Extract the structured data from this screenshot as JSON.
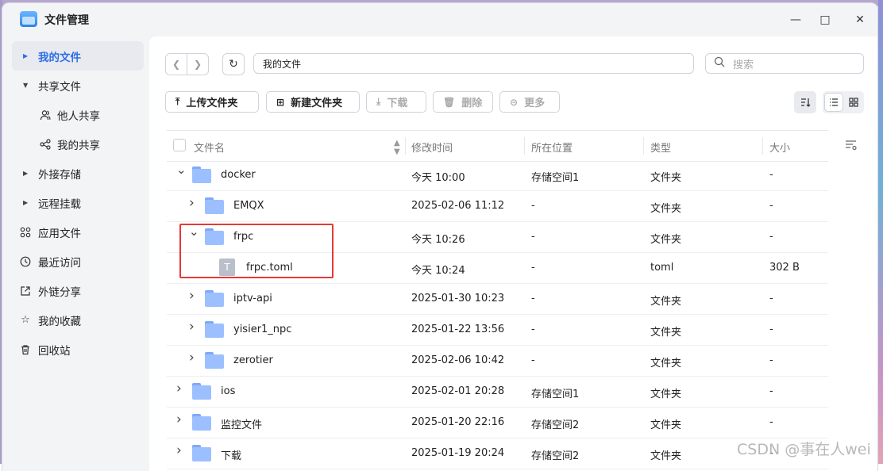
{
  "window": {
    "title": "文件管理",
    "minimize_icon": "minimize-icon",
    "maximize_icon": "maximize-icon",
    "close_icon": "close-icon"
  },
  "sidebar": {
    "items": [
      {
        "label": "我的文件",
        "icon": "caret-right-icon",
        "active": true
      },
      {
        "label": "共享文件",
        "icon": "caret-down-icon"
      },
      {
        "label": "他人共享",
        "icon": "users-icon",
        "sub": true
      },
      {
        "label": "我的共享",
        "icon": "share-icon",
        "sub": true
      },
      {
        "label": "外接存储",
        "icon": "caret-right-icon"
      },
      {
        "label": "远程挂载",
        "icon": "caret-right-icon"
      },
      {
        "label": "应用文件",
        "icon": "apps-icon"
      },
      {
        "label": "最近访问",
        "icon": "clock-icon"
      },
      {
        "label": "外链分享",
        "icon": "external-link-icon"
      },
      {
        "label": "我的收藏",
        "icon": "star-icon"
      },
      {
        "label": "回收站",
        "icon": "trash-icon"
      }
    ]
  },
  "toolbar": {
    "path": "我的文件",
    "search_placeholder": "搜索",
    "upload_label": "上传文件夹",
    "new_folder_label": "新建文件夹",
    "download_label": "下载",
    "delete_label": "删除",
    "more_label": "更多"
  },
  "table": {
    "headers": {
      "name": "文件名",
      "modified": "修改时间",
      "location": "所在位置",
      "type": "类型",
      "size": "大小"
    },
    "rows": [
      {
        "name": "docker",
        "modified": "今天 10:00",
        "location": "存储空间1",
        "type": "文件夹",
        "size": "-",
        "level": 0,
        "kind": "folder",
        "expand": "down"
      },
      {
        "name": "EMQX",
        "modified": "2025-02-06 11:12",
        "location": "-",
        "type": "文件夹",
        "size": "-",
        "level": 1,
        "kind": "folder",
        "expand": "right"
      },
      {
        "name": "frpc",
        "modified": "今天 10:26",
        "location": "-",
        "type": "文件夹",
        "size": "-",
        "level": 1,
        "kind": "folder",
        "expand": "down"
      },
      {
        "name": "frpc.toml",
        "modified": "今天 10:24",
        "location": "-",
        "type": "toml",
        "size": "302 B",
        "level": 2,
        "kind": "file",
        "expand": ""
      },
      {
        "name": "iptv-api",
        "modified": "2025-01-30 10:23",
        "location": "-",
        "type": "文件夹",
        "size": "-",
        "level": 1,
        "kind": "folder",
        "expand": "right"
      },
      {
        "name": "yisier1_npc",
        "modified": "2025-01-22 13:56",
        "location": "-",
        "type": "文件夹",
        "size": "-",
        "level": 1,
        "kind": "folder",
        "expand": "right"
      },
      {
        "name": "zerotier",
        "modified": "2025-02-06 10:42",
        "location": "-",
        "type": "文件夹",
        "size": "-",
        "level": 1,
        "kind": "folder",
        "expand": "right"
      },
      {
        "name": "ios",
        "modified": "2025-02-01 20:28",
        "location": "存储空间1",
        "type": "文件夹",
        "size": "-",
        "level": 0,
        "kind": "folder",
        "expand": "right"
      },
      {
        "name": "监控文件",
        "modified": "2025-01-20 22:16",
        "location": "存储空间2",
        "type": "文件夹",
        "size": "-",
        "level": 0,
        "kind": "folder",
        "expand": "right"
      },
      {
        "name": "下载",
        "modified": "2025-01-19 20:24",
        "location": "存储空间2",
        "type": "文件夹",
        "size": "-",
        "level": 0,
        "kind": "folder",
        "expand": "right"
      }
    ]
  },
  "watermark": "CSDN @事在人wei"
}
